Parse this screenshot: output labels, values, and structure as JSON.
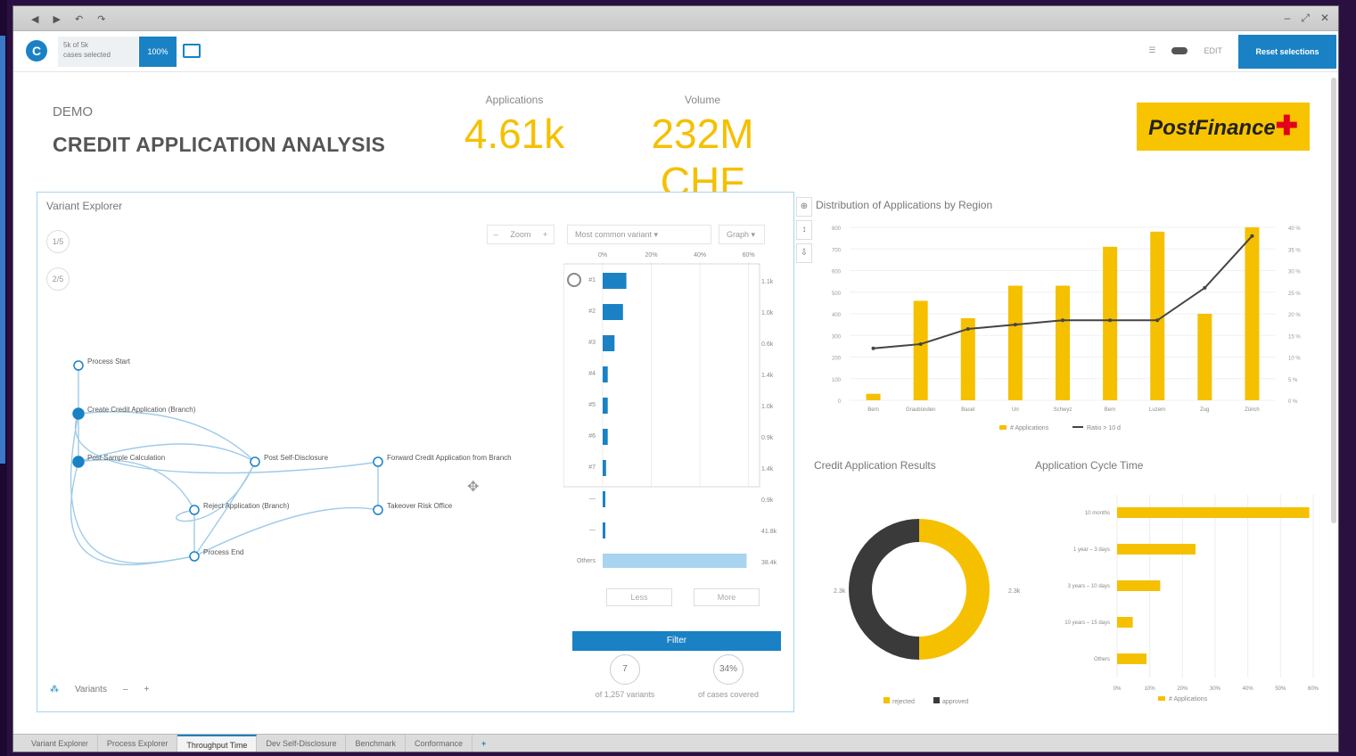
{
  "window": {
    "controls": [
      "–",
      "⤢",
      "✕"
    ],
    "toolbar_icons": [
      "◀",
      "▶",
      "↶",
      "↷"
    ]
  },
  "toolbar": {
    "logo_letter": "C",
    "selection_line1": "5k of 5k",
    "selection_line2": "cases selected",
    "percent_label": "100%",
    "menu_item": "☰",
    "edit_label": "EDIT",
    "reset_label": "Reset selections"
  },
  "header": {
    "demo": "DEMO",
    "title": "CREDIT APPLICATION ANALYSIS",
    "kpis": [
      {
        "label": "Applications",
        "value": "4.61k"
      },
      {
        "label": "Volume",
        "value": "232M CHF"
      }
    ],
    "brand": "PostFinance",
    "brand_plus": "✚"
  },
  "variant_explorer": {
    "title": "Variant Explorer",
    "zoom_label": "Zoom",
    "zoom_minus": "–",
    "zoom_plus": "+",
    "variant_dropdown": "Most common variant",
    "graph_dropdown": "Graph",
    "side_buttons": [
      "1/5",
      "2/5"
    ],
    "nodes": [
      {
        "label": "Process Start"
      },
      {
        "label": "Create Credit Application (Branch)"
      },
      {
        "label": "Post Sample Calculation"
      },
      {
        "label": "Post Self-Disclosure"
      },
      {
        "label": "Forward Credit Application from Branch"
      },
      {
        "label": "Reject Application (Branch)"
      },
      {
        "label": "Takeover Risk Office"
      },
      {
        "label": "Process End"
      }
    ],
    "footer_label": "Variants",
    "footer_minus": "–",
    "footer_plus": "+",
    "filter_label": "Filter",
    "scroll_up": "Less",
    "scroll_down": "More",
    "variants_count": "7",
    "variants_label": "of 1,257 variants",
    "coverage": "34%",
    "coverage_label": "of cases covered",
    "pct_axis": [
      "0%",
      "20%",
      "40%",
      "60%"
    ],
    "variant_rows": [
      {
        "label": "#1",
        "value": 0.14,
        "text": "1.1k"
      },
      {
        "label": "#2",
        "value": 0.12,
        "text": "1.0k"
      },
      {
        "label": "#3",
        "value": 0.07,
        "text": "0.6k"
      },
      {
        "label": "#4",
        "value": 0.03,
        "text": "1.4k"
      },
      {
        "label": "#5",
        "value": 0.03,
        "text": "1.0k"
      },
      {
        "label": "#6",
        "value": 0.03,
        "text": "0.9k"
      },
      {
        "label": "#7",
        "value": 0.02,
        "text": "1.4k"
      },
      {
        "label": "—",
        "value": 0.01,
        "text": "0.9k"
      },
      {
        "label": "—",
        "value": 0.01,
        "text": "41.8k"
      },
      {
        "label": "Others",
        "value": 0.85,
        "text": "38.4k"
      }
    ]
  },
  "side_tools": [
    "⊕",
    "↕",
    "⇩"
  ],
  "chart_region": {
    "title": "Distribution of Applications by Region",
    "legend_bar": "# Applications",
    "legend_line": "Ratio > 10 d",
    "chart_data": {
      "type": "bar",
      "categories": [
        "Bern",
        "Graubünden",
        "Basel",
        "Uri",
        "Schwyz",
        "Bern",
        "Luzern",
        "Zug",
        "Zürich"
      ],
      "series": [
        {
          "name": "# Applications",
          "type": "bar",
          "values": [
            30,
            460,
            380,
            530,
            530,
            710,
            780,
            400,
            800
          ]
        },
        {
          "name": "Ratio > 10 d",
          "type": "line",
          "values": [
            0.12,
            0.13,
            0.165,
            0.175,
            0.185,
            0.185,
            0.185,
            0.26,
            0.38
          ]
        }
      ],
      "ylim": [
        0,
        800
      ],
      "y2lim": [
        0,
        0.4
      ],
      "yticks": [
        "0",
        "100",
        "200",
        "300",
        "400",
        "500",
        "600",
        "700",
        "800"
      ],
      "y2ticks": [
        "0 %",
        "5 %",
        "10 %",
        "15 %",
        "20 %",
        "25 %",
        "30 %",
        "35 %",
        "40 %"
      ]
    }
  },
  "chart_results": {
    "title": "Credit Application Results",
    "legend": [
      "rejected",
      "approved"
    ],
    "chart_data": {
      "type": "pie",
      "labels": [
        "rejected",
        "approved"
      ],
      "values": [
        50,
        50
      ],
      "left_label": "2.3k",
      "right_label": "2.3k"
    }
  },
  "chart_cycle": {
    "title": "Application Cycle Time",
    "legend": "# Applications",
    "chart_data": {
      "type": "bar",
      "orientation": "horizontal",
      "categories": [
        "10 months",
        "1 year – 3 days",
        "3 years – 10 days",
        "10 years – 15 days",
        "Others"
      ],
      "values": [
        0.98,
        0.4,
        0.22,
        0.08,
        0.15
      ],
      "xticks": [
        "0%",
        "10%",
        "20%",
        "30%",
        "40%",
        "50%",
        "60%"
      ]
    }
  },
  "colors": {
    "accent": "#1a82c4",
    "yellow": "#f5c000",
    "dark": "#3a3a3a"
  },
  "bottom_tabs": [
    "Variant Explorer",
    "Process Explorer",
    "Throughput Time",
    "Dev Self-Disclosure",
    "Benchmark",
    "Conformance",
    "+"
  ]
}
